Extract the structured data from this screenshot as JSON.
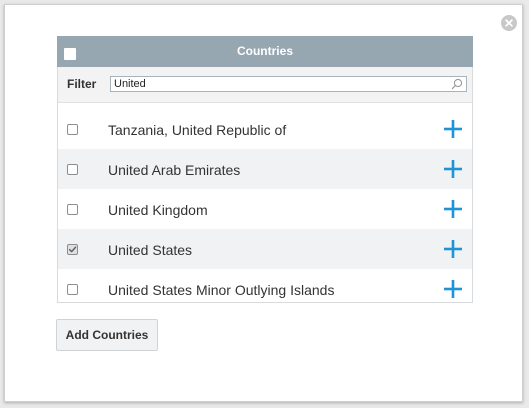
{
  "dialog": {
    "close_icon": "close-circle-icon"
  },
  "panel": {
    "title": "Countries",
    "header_color": "#96a7b2",
    "filter": {
      "label": "Filter",
      "value": "United",
      "icon": "search-icon"
    },
    "rows": [
      {
        "label": "Tanzania, United Republic of",
        "checked": false
      },
      {
        "label": "United Arab Emirates",
        "checked": false
      },
      {
        "label": "United Kingdom",
        "checked": false
      },
      {
        "label": "United States",
        "checked": true
      },
      {
        "label": "United States Minor Outlying Islands",
        "checked": false
      }
    ],
    "add_icon": "plus-icon",
    "add_icon_color": "#1e93d6"
  },
  "footer": {
    "add_button_label": "Add Countries"
  }
}
